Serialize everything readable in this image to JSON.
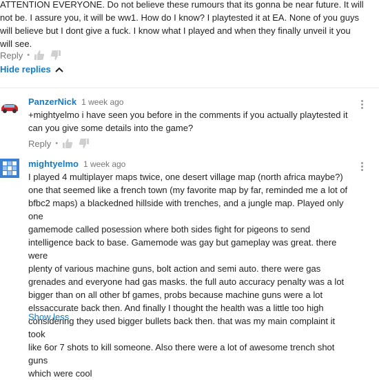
{
  "top_comment": {
    "lines": [
      "ATTENTION EVERYONE. Do not believe these rumours that its gonna be near future. It will",
      "not be. I assure you, it will be ww1. How do I know? I playtested it at EA. None of you guys",
      "will believe but I dont give a fuck. I know what I played and when they finally unveil it you",
      "will see."
    ],
    "reply_label": "Reply",
    "separator": "•"
  },
  "hide_replies_label": "Hide replies",
  "replies": [
    {
      "author": "PanzerNick",
      "time": "1 week ago",
      "lines": [
        "+mightyelmo i have seen you before in the comments if you actually  playtested it",
        "can you give some details into the game?"
      ],
      "reply_label": "Reply",
      "separator": "•"
    },
    {
      "author": "mightyelmo",
      "time": "1 week ago",
      "lines": [
        "I played 4 multiplayer maps twice, one desert village map (north africa maybe?)",
        "one that seemed like a french town (my favorite map by far, reminded me a lot of",
        "bfbc2 maps) a blackedned hillside with trenches, and a jungle map. Played only one",
        "gamemode called posession where both sides fight for pigeons to send",
        "intelligence back to base. Gamemode was gay but gameplay was great. there were",
        "plenty of various machine guns, bolt action and semi auto. there were gas",
        "grenades and everyone had gas masks. the full auto accuracy penalty was a lot",
        "bigger than on all other bf games, probs because machine guns were a lot",
        "elssaccurate back then. And finally I thought the health was a little too high",
        "considering they used bigger bullets back then. that was my main complaint it took",
        "like 6or 7 shots to kill someone. Also there were a lot of awesome trench shot guns",
        "which were cool"
      ],
      "show_less_label": "Show less"
    }
  ],
  "colors": {
    "link": "#167ac6",
    "meta": "#767676",
    "text": "#222222"
  }
}
